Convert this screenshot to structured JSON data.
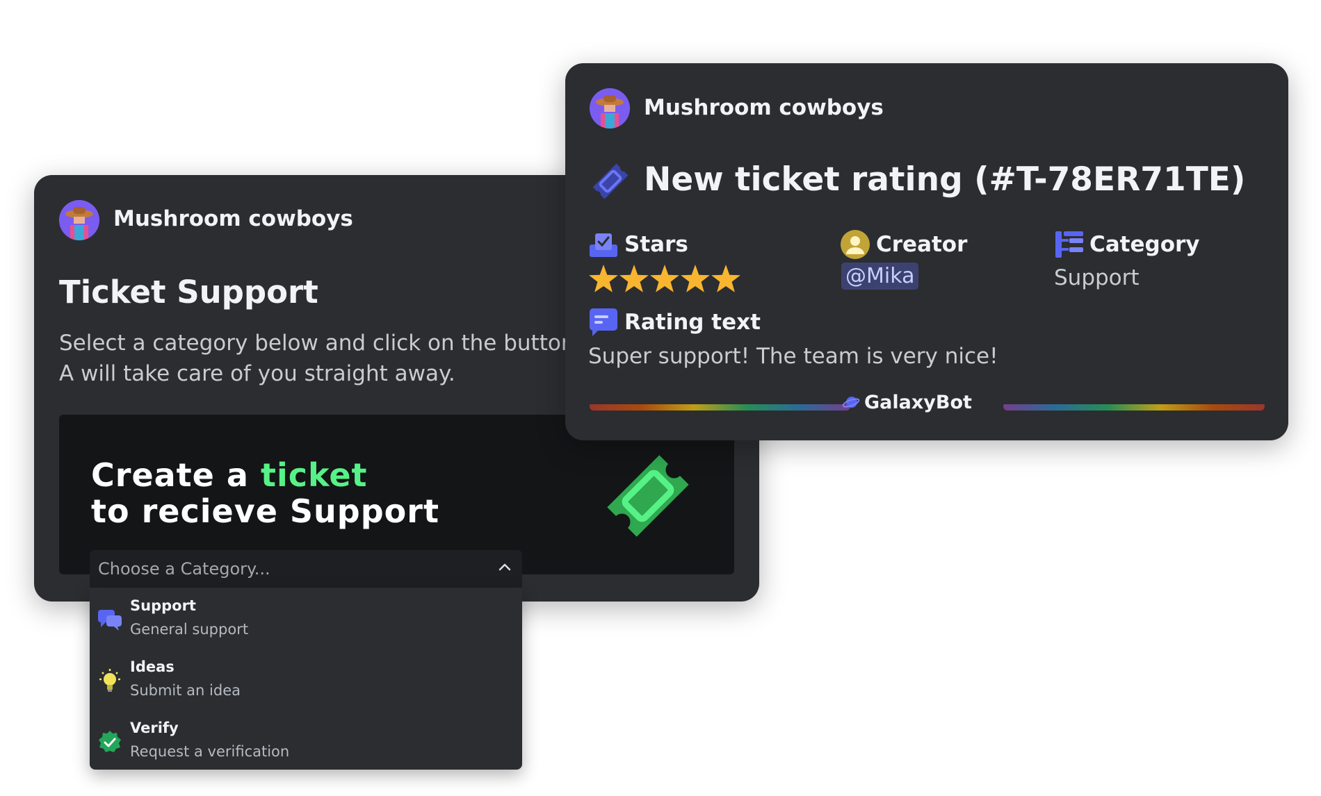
{
  "left_card": {
    "author": "Mushroom cowboys",
    "title": "Ticket Support",
    "description": "Select a category below and click on the button. A will take care of you straight away.",
    "banner": {
      "line1_prefix": "Create a ",
      "line1_accent": "ticket",
      "line2": "to recieve Support",
      "accent_color": "#57f287",
      "icon": "ticket-icon"
    }
  },
  "dropdown": {
    "placeholder": "Choose a Category...",
    "expanded": true,
    "options": [
      {
        "label": "Support",
        "description": "General support",
        "icon": "speech-bubbles-icon"
      },
      {
        "label": "Ideas",
        "description": "Submit an idea",
        "icon": "lightbulb-icon"
      },
      {
        "label": "Verify",
        "description": "Request a verification",
        "icon": "verified-check-icon"
      }
    ]
  },
  "right_card": {
    "author": "Mushroom cowboys",
    "title": "New ticket rating (#T-78ER71TE)",
    "fields": {
      "stars": {
        "name": "Stars",
        "rating": 5,
        "max": 5
      },
      "creator": {
        "name": "Creator",
        "value": "@Mika"
      },
      "category": {
        "name": "Category",
        "value": "Support"
      },
      "rating_text": {
        "name": "Rating text",
        "value": "Super support! The team is very nice!"
      }
    },
    "footer": "GalaxyBot"
  },
  "colors": {
    "card_bg": "#2b2d31",
    "blurple": "#5865f2",
    "star": "#f8b530",
    "mention_bg": "#3c4270"
  }
}
